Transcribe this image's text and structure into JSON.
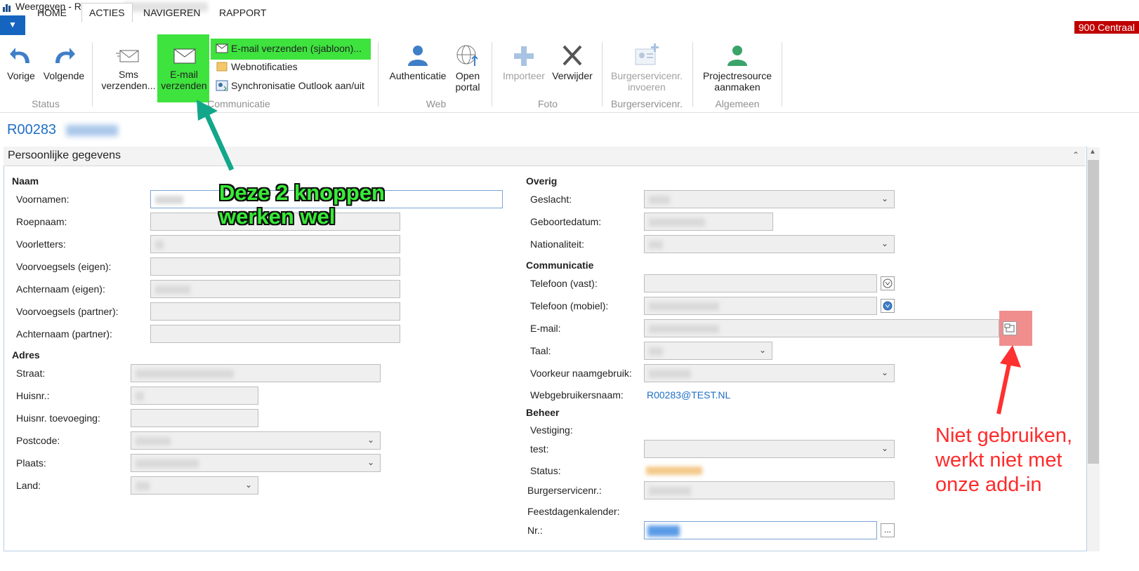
{
  "window": {
    "title": "Weergeven - Resource -"
  },
  "tabs": [
    "HOME",
    "ACTIES",
    "NAVIGEREN",
    "RAPPORT"
  ],
  "company": "900 Centraal",
  "ribbon": {
    "status": {
      "label": "Status",
      "prev": "Vorige",
      "next": "Volgende"
    },
    "communicatie": {
      "label": "Communicatie",
      "sms": "Sms verzenden...",
      "email": "E-mail verzenden",
      "email_template": "E-mail verzenden (sjabloon)...",
      "webnotificaties": "Webnotificaties",
      "outlook_sync": "Synchronisatie Outlook aan/uit"
    },
    "web": {
      "label": "Web",
      "auth": "Authenticatie",
      "portal": "Open portal"
    },
    "foto": {
      "label": "Foto",
      "import": "Importeer",
      "delete": "Verwijder"
    },
    "bsn": {
      "label": "Burgerservicenr.",
      "invoeren": "Burgerservicenr. invoeren"
    },
    "algemeen": {
      "label": "Algemeen",
      "project": "Projectresource aanmaken"
    }
  },
  "record": {
    "id": "R00283"
  },
  "section": {
    "title": "Persoonlijke gegevens",
    "naam": {
      "header": "Naam",
      "voornamen": "Voornamen:",
      "roepnaam": "Roepnaam:",
      "voorletters": "Voorletters:",
      "voorvoegsels_eigen": "Voorvoegsels (eigen):",
      "achternaam_eigen": "Achternaam (eigen):",
      "voorvoegsels_partner": "Voorvoegsels (partner):",
      "achternaam_partner": "Achternaam (partner):"
    },
    "adres": {
      "header": "Adres",
      "straat": "Straat:",
      "huisnr": "Huisnr.:",
      "huisnr_toev": "Huisnr. toevoeging:",
      "postcode": "Postcode:",
      "plaats": "Plaats:",
      "land": "Land:"
    },
    "overig": {
      "header": "Overig",
      "geslacht": "Geslacht:",
      "geboortedatum": "Geboortedatum:",
      "nationaliteit": "Nationaliteit:"
    },
    "communicatie": {
      "header": "Communicatie",
      "tel_vast": "Telefoon (vast):",
      "tel_mobiel": "Telefoon (mobiel):",
      "email": "E-mail:",
      "taal": "Taal:",
      "voorkeur": "Voorkeur naamgebruik:",
      "webuser_label": "Webgebruikersnaam:",
      "webuser_value": "R00283@TEST.NL"
    },
    "beheer": {
      "header": "Beheer",
      "vestiging": "Vestiging:",
      "test": "test:",
      "status": "Status:",
      "bsn": "Burgerservicenr.:",
      "feestdagen": "Feestdagenkalender:",
      "nr": "Nr.:",
      "nr_button": "..."
    }
  },
  "annotations": {
    "green": "Deze 2 knoppen\nwerken wel",
    "red_1": "Niet gebruiken,",
    "red_2": "werkt niet met",
    "red_3": "onze add-in"
  }
}
